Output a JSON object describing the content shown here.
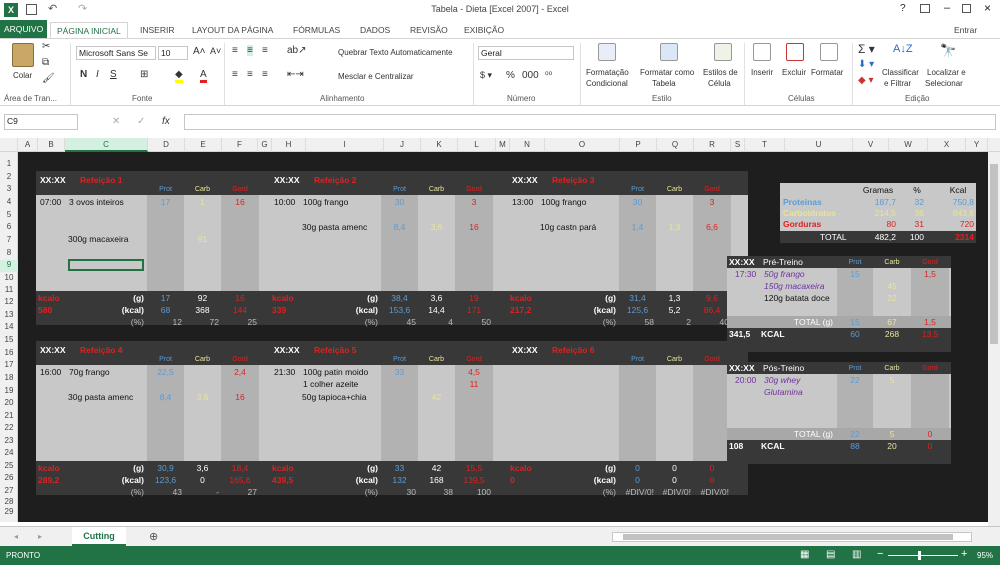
{
  "window": {
    "title": "Tabela - Dieta [Excel 2007] - Excel",
    "help": "?",
    "signin": "Entrar"
  },
  "tabs": [
    "ARQUIVO",
    "PÁGINA INICIAL",
    "INSERIR",
    "LAYOUT DA PÁGINA",
    "FÓRMULAS",
    "DADOS",
    "REVISÃO",
    "EXIBIÇÃO"
  ],
  "ribbon": {
    "paste": "Colar",
    "font_name": "Microsoft Sans Se",
    "font_size": "10",
    "wrap": "Quebrar Texto Automaticamente",
    "merge": "Mesclar e Centralizar",
    "number_format": "Geral",
    "cond_fmt": [
      "Formatação",
      "Condicional"
    ],
    "fmt_table": [
      "Formatar como",
      "Tabela"
    ],
    "cell_styles": [
      "Estilos de",
      "Célula"
    ],
    "insert": "Inserir",
    "delete": "Excluir",
    "format": "Formatar",
    "sort": [
      "Classificar",
      "e Filtrar"
    ],
    "find": [
      "Localizar e",
      "Selecionar"
    ],
    "groups": [
      "Área de Tran...",
      "Fonte",
      "Alinhamento",
      "Número",
      "Estilo",
      "Células",
      "Edição"
    ]
  },
  "namebox": "C9",
  "fx": "fx",
  "columns": [
    "A",
    "B",
    "C",
    "D",
    "E",
    "F",
    "G",
    "H",
    "I",
    "J",
    "K",
    "L",
    "M",
    "N",
    "O",
    "P",
    "Q",
    "R",
    "S",
    "T",
    "U",
    "V",
    "W",
    "X",
    "Y"
  ],
  "rows": [
    "1",
    "2",
    "3",
    "4",
    "5",
    "6",
    "7",
    "8",
    "9",
    "10",
    "11",
    "12",
    "13",
    "14",
    "15",
    "16",
    "17",
    "18",
    "19",
    "20",
    "21",
    "22",
    "23",
    "24",
    "25",
    "26",
    "27",
    "28",
    "29"
  ],
  "meals": [
    {
      "time": "XX:XX",
      "name": "Refeição 1",
      "items": [
        {
          "t": "07:00",
          "d": "3 ovos inteiros",
          "p": "17",
          "c": "1",
          "g": "16"
        },
        {
          "t": "",
          "d": "300g macaxeira",
          "p": "",
          "c": "91",
          "g": ""
        }
      ],
      "g": [
        "17",
        "92",
        "16"
      ],
      "kcal": [
        "68",
        "368",
        "144"
      ],
      "pct": [
        "12",
        "72",
        "25"
      ],
      "kcalTotal": "580"
    },
    {
      "time": "XX:XX",
      "name": "Refeição 2",
      "items": [
        {
          "t": "10:00",
          "d": "100g frango",
          "p": "30",
          "c": "",
          "g": "3"
        },
        {
          "t": "",
          "d": "30g pasta amenc",
          "p": "8,4",
          "c": "3,6",
          "g": "16"
        }
      ],
      "g": [
        "38,4",
        "3,6",
        "19"
      ],
      "kcal": [
        "153,6",
        "14,4",
        "171"
      ],
      "pct": [
        "45",
        "4",
        "50"
      ],
      "kcalTotal": "339"
    },
    {
      "time": "XX:XX",
      "name": "Refeição 3",
      "items": [
        {
          "t": "13:00",
          "d": "100g frango",
          "p": "30",
          "c": "",
          "g": "3"
        },
        {
          "t": "",
          "d": "10g castn pará",
          "p": "1,4",
          "c": "1,3",
          "g": "6,6"
        }
      ],
      "g": [
        "31,4",
        "1,3",
        "9,6"
      ],
      "kcal": [
        "125,6",
        "5,2",
        "86,4"
      ],
      "pct": [
        "58",
        "2",
        "40"
      ],
      "kcalTotal": "217,2"
    },
    {
      "time": "XX:XX",
      "name": "Refeição 4",
      "items": [
        {
          "t": "16:00",
          "d": "70g frango",
          "p": "22,5",
          "c": "",
          "g": "2,4"
        },
        {
          "t": "",
          "d": "30g pasta amenc",
          "p": "8,4",
          "c": "3,6",
          "g": "16"
        }
      ],
      "g": [
        "30,9",
        "3,6",
        "18,4"
      ],
      "kcal": [
        "123,6",
        "0",
        "165,6"
      ],
      "pct": [
        "43",
        "-",
        "27"
      ],
      "kcalTotal": "289,2"
    },
    {
      "time": "XX:XX",
      "name": "Refeição 5",
      "items": [
        {
          "t": "21:30",
          "d": "100g patin moido",
          "p": "33",
          "c": "",
          "g": "4,5"
        },
        {
          "t": "",
          "d": "1 colher azeite",
          "p": "",
          "c": "",
          "g": "11"
        },
        {
          "t": "",
          "d": "50g tapioca+chia",
          "p": "",
          "c": "42",
          "g": ""
        }
      ],
      "g": [
        "33",
        "42",
        "15,5"
      ],
      "kcal": [
        "132",
        "168",
        "139,5"
      ],
      "pct": [
        "30",
        "38",
        "100"
      ],
      "kcalTotal": "439,5"
    },
    {
      "time": "XX:XX",
      "name": "Refeição 6",
      "items": [],
      "g": [
        "0",
        "0",
        "0"
      ],
      "kcal": [
        "0",
        "0",
        "0"
      ],
      "pct": [
        "#DIV/0!",
        "#DIV/0!",
        "#DIV/0!"
      ],
      "kcalTotal": "0"
    }
  ],
  "labels": {
    "prot": "Prot",
    "carb": "Carb",
    "gord": "Gord",
    "kcalo": "kcalo",
    "g": "(g)",
    "kcal": "(kcal)",
    "pct": "(%)"
  },
  "summary": {
    "headers": [
      "Gramas",
      "%",
      "Kcal"
    ],
    "rows": [
      {
        "n": "Proteinas",
        "g": "187,7",
        "p": "32",
        "k": "750,8"
      },
      {
        "n": "Carboidratos",
        "g": "214,5",
        "p": "36",
        "k": "843,6"
      },
      {
        "n": "Gorduras",
        "g": "80",
        "p": "31",
        "k": "720"
      }
    ],
    "total": {
      "n": "TOTAL",
      "g": "482,2",
      "p": "100",
      "k": "2314"
    }
  },
  "pretreino": {
    "time": "XX:XX",
    "name": "Pré-Treino",
    "items": [
      {
        "t": "17:30",
        "d": "50g frango",
        "p": "15",
        "c": "",
        "g": "1,5"
      },
      {
        "t": "",
        "d": "150g macaxeira",
        "p": "",
        "c": "45",
        "g": ""
      },
      {
        "t": "",
        "d": "120g batata doce",
        "p": "",
        "c": "22",
        "g": ""
      }
    ],
    "total_label": "TOTAL (g)",
    "total": [
      "15",
      "67",
      "1,5"
    ],
    "kcal": [
      "60",
      "268",
      "13,5"
    ],
    "kcalTotal": "341,5",
    "kcalLabel": "KCAL"
  },
  "postreino": {
    "time": "XX:XX",
    "name": "Pós-Treino",
    "items": [
      {
        "t": "20:00",
        "d": "30g whey",
        "p": "22",
        "c": "5",
        "g": ""
      },
      {
        "t": "",
        "d": "Glutamina",
        "p": "",
        "c": "",
        "g": ""
      }
    ],
    "total_label": "TOTAL (g)",
    "total": [
      "22",
      "5",
      "0"
    ],
    "kcal": [
      "88",
      "20",
      "0"
    ],
    "kcalTotal": "108",
    "kcalLabel": "KCAL"
  },
  "sheet": "Cutting",
  "status": {
    "ready": "PRONTO",
    "zoom": "95%"
  }
}
